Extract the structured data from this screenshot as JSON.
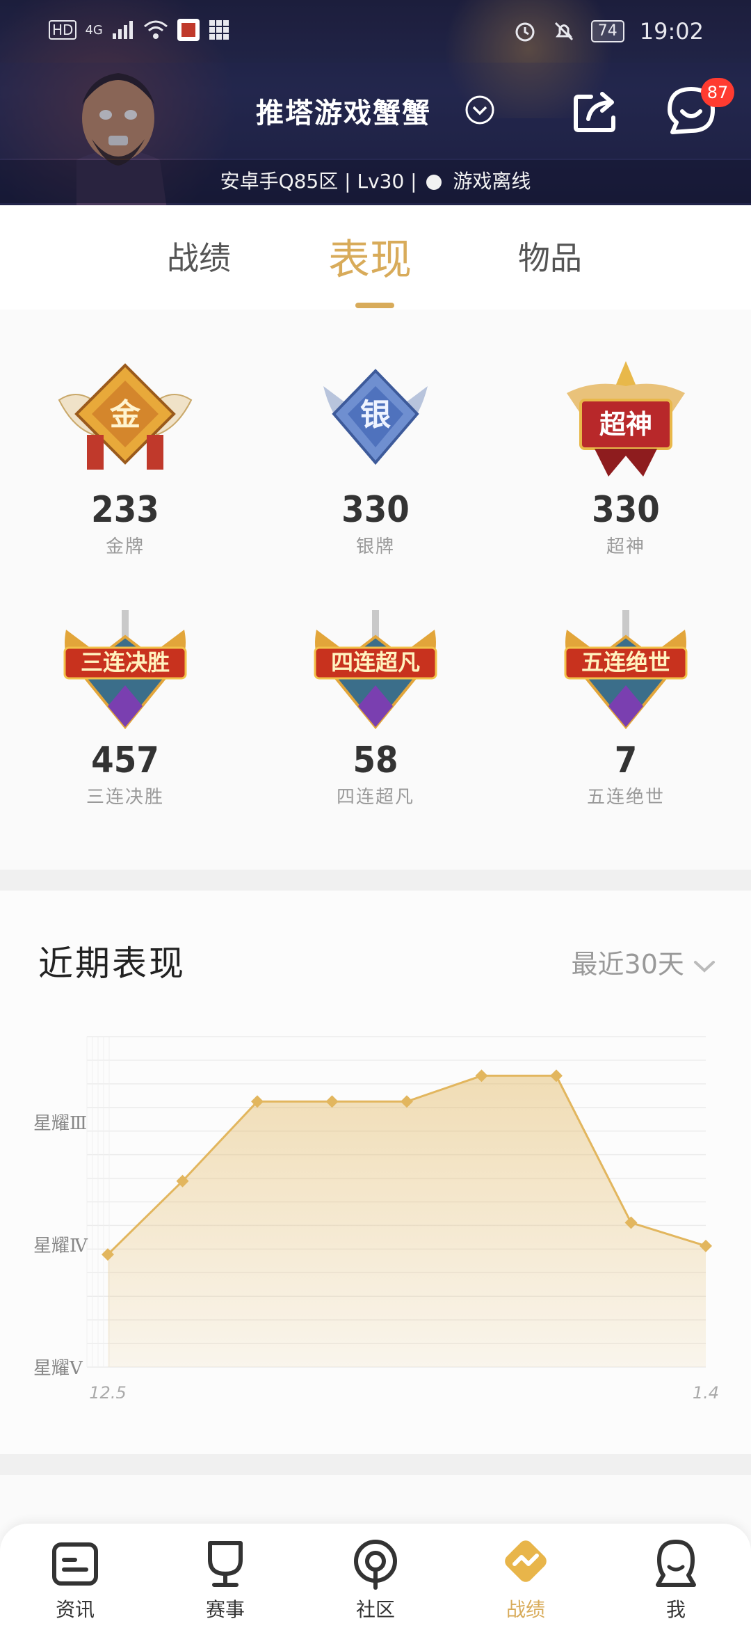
{
  "status_bar": {
    "left_labels": [
      "HD",
      "4G"
    ],
    "battery": "74",
    "time": "19:02"
  },
  "header": {
    "title": "推塔游戏蟹蟹",
    "message_badge": "87",
    "subline_text": "安卓手Q85区 | Lv30 |",
    "online_status": "游戏离线"
  },
  "tabs": [
    {
      "label": "战绩"
    },
    {
      "label": "表现"
    },
    {
      "label": "物品"
    }
  ],
  "medals": [
    {
      "count": "233",
      "label": "金牌",
      "badge_text": "金"
    },
    {
      "count": "330",
      "label": "银牌",
      "badge_text": "银"
    },
    {
      "count": "330",
      "label": "超神",
      "badge_text": "超神"
    },
    {
      "count": "457",
      "label": "三连决胜",
      "badge_text": "三连决胜"
    },
    {
      "count": "58",
      "label": "四连超凡",
      "badge_text": "四连超凡"
    },
    {
      "count": "7",
      "label": "五连绝世",
      "badge_text": "五连绝世"
    }
  ],
  "performance": {
    "title": "近期表现",
    "range_label": "最近30天"
  },
  "chart_data": {
    "type": "area",
    "title": "",
    "xlabel": "",
    "ylabel": "",
    "x_tick_labels": [
      "12.5",
      "1.4"
    ],
    "y_tick_labels": [
      "星耀Ⅲ",
      "星耀Ⅳ",
      "星耀Ⅴ"
    ],
    "y_tick_values": [
      3,
      2,
      1
    ],
    "ylim": [
      1,
      3.7
    ],
    "values": [
      1.92,
      2.52,
      3.17,
      3.17,
      3.17,
      3.38,
      3.38,
      2.18,
      1.99
    ],
    "color": "#e2b65e",
    "grid": true
  },
  "bottom_nav": [
    {
      "label": "资讯",
      "icon": "news-icon"
    },
    {
      "label": "赛事",
      "icon": "trophy-icon"
    },
    {
      "label": "社区",
      "icon": "community-icon"
    },
    {
      "label": "战绩",
      "icon": "record-icon"
    },
    {
      "label": "我",
      "icon": "profile-icon"
    }
  ],
  "colors": {
    "accent": "#d8ab5a",
    "badge_red": "#ff3b30"
  }
}
